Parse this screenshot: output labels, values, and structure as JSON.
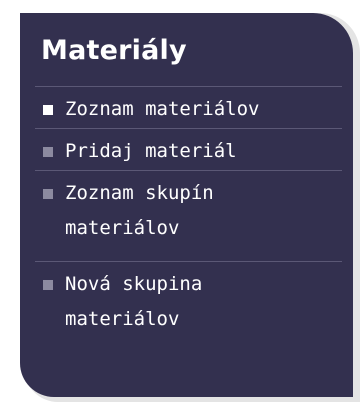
{
  "panel": {
    "title": "Materiály",
    "items": [
      {
        "label": "Zoznam materiálov",
        "active": true
      },
      {
        "label": "Pridaj materiál",
        "active": false
      },
      {
        "label": "Zoznam skupín materiálov",
        "active": false
      },
      {
        "label": "Nová skupina materiálov",
        "active": false
      }
    ]
  }
}
